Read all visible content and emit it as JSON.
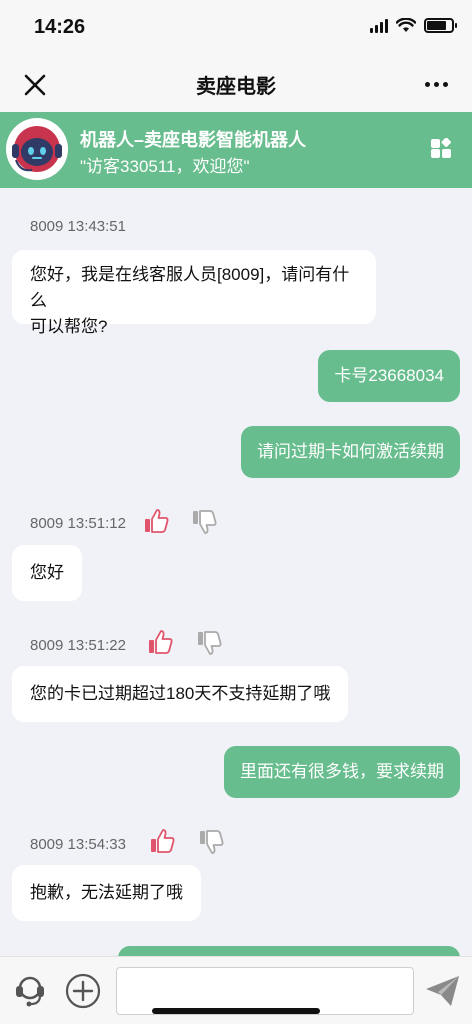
{
  "status_bar": {
    "time": "14:26"
  },
  "nav": {
    "title": "卖座电影"
  },
  "robot": {
    "name": "机器人–卖座电影智能机器人",
    "greeting": "\"访客330511，欢迎您\""
  },
  "messages": [
    {
      "side": "left",
      "sender_time": "8009 13:43:51",
      "text_lines": [
        "您好，我是在线客服人员[8009]，请问有什么",
        "可以帮您?"
      ],
      "rating": false
    },
    {
      "side": "right",
      "text": "卡号23668034"
    },
    {
      "side": "right",
      "text": "请问过期卡如何激活续期"
    },
    {
      "side": "left",
      "sender_time": "8009 13:51:12",
      "text": "您好",
      "rating": true
    },
    {
      "side": "left",
      "sender_time": "8009 13:51:22",
      "text": "您的卡已过期超过180天不支持延期了哦",
      "rating": true
    },
    {
      "side": "right",
      "text": "里面还有很多钱，要求续期"
    },
    {
      "side": "left",
      "sender_time": "8009 13:54:33",
      "text": "抱歉，无法延期了哦",
      "rating": true
    }
  ],
  "icons": {
    "close": "close-icon",
    "more": "more-icon",
    "robot_avatar": "robot-avatar-icon",
    "banner_menu": "grid-icon",
    "thumb_up": "thumbs-up-icon",
    "thumb_down": "thumbs-down-icon",
    "headset": "headset-icon",
    "plus": "plus-circle-icon",
    "send": "send-icon"
  },
  "colors": {
    "accent": "#67bd8d",
    "thumb_up": "#e0556b",
    "background": "#f0f2f7"
  }
}
